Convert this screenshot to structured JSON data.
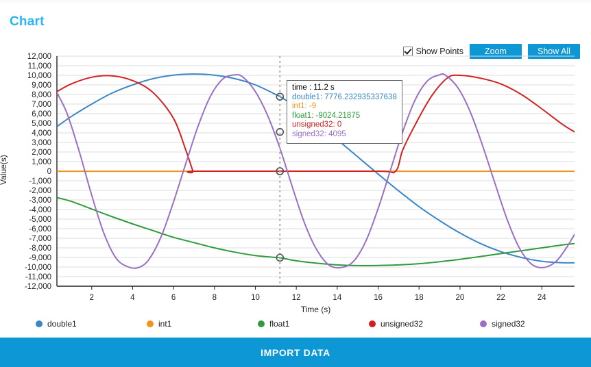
{
  "card": {
    "title": "Chart"
  },
  "toolbar": {
    "show_points_label": "Show Points",
    "show_points_checked": true,
    "zoom_label": "Zoom",
    "show_all_label": "Show All"
  },
  "import": {
    "label": "IMPORT DATA"
  },
  "tooltip": {
    "time": "time : 11.2 s",
    "rows": [
      {
        "text": "double1: 7776.232935337638",
        "color": "#3a87c8"
      },
      {
        "text": "int1: -9",
        "color": "#f0941e"
      },
      {
        "text": "float1: -9024.21875",
        "color": "#2e9b3c"
      },
      {
        "text": "unsigned32: 0",
        "color": "#d32020"
      },
      {
        "text": "signed32: 4095",
        "color": "#9b6fc4"
      }
    ]
  },
  "chart_data": {
    "type": "line",
    "title": "Chart",
    "xlabel": "Time (s)",
    "ylabel": "Value(s)",
    "xlim": [
      0.3,
      25.6
    ],
    "ylim": [
      -12000,
      12000
    ],
    "xticks": [
      2,
      4,
      6,
      8,
      10,
      12,
      14,
      16,
      18,
      20,
      22,
      24
    ],
    "yticks": [
      12000,
      11000,
      10000,
      9000,
      8000,
      7000,
      6000,
      5000,
      4000,
      3000,
      2000,
      1000,
      0,
      -1000,
      -2000,
      -3000,
      -4000,
      -5000,
      -6000,
      -7000,
      -8000,
      -9000,
      -10000,
      -11000,
      -12000
    ],
    "ytick_labels": [
      "12,000",
      "11,000",
      "10,000",
      "9,000",
      "8,000",
      "7,000",
      "6,000",
      "5,000",
      "4,000",
      "3,000",
      "2,000",
      "1,000",
      "0",
      "-1,000",
      "-2,000",
      "-3,000",
      "-4,000",
      "-5,000",
      "-6,000",
      "-7,000",
      "-8,000",
      "-9,000",
      "-10,000",
      "-11,000",
      "-12,000"
    ],
    "grid": true,
    "grid_color": "#dcdcdc",
    "legend_position": "bottom",
    "cursor_x": 11.2,
    "series": [
      {
        "name": "double1",
        "color": "#3a87c8",
        "marker_at_cursor": 7776.23,
        "points": [
          [
            0.3,
            4650
          ],
          [
            1.0,
            5700
          ],
          [
            2.0,
            7000
          ],
          [
            3.0,
            8150
          ],
          [
            4.0,
            9000
          ],
          [
            5.0,
            9650
          ],
          [
            6.0,
            10020
          ],
          [
            7.0,
            10130
          ],
          [
            8.0,
            10020
          ],
          [
            9.0,
            9650
          ],
          [
            10.0,
            9000
          ],
          [
            11.0,
            8000
          ],
          [
            11.2,
            7776
          ],
          [
            12.0,
            6700
          ],
          [
            13.0,
            5100
          ],
          [
            14.0,
            3300
          ],
          [
            15.0,
            1500
          ],
          [
            16.0,
            -300
          ],
          [
            17.0,
            -2050
          ],
          [
            18.0,
            -3700
          ],
          [
            19.0,
            -5150
          ],
          [
            20.0,
            -6450
          ],
          [
            21.0,
            -7550
          ],
          [
            22.0,
            -8400
          ],
          [
            23.0,
            -9000
          ],
          [
            24.0,
            -9400
          ],
          [
            25.0,
            -9550
          ],
          [
            25.6,
            -9560
          ]
        ]
      },
      {
        "name": "int1",
        "color": "#f0941e",
        "marker_at_cursor": -9,
        "points": [
          [
            0.3,
            -9
          ],
          [
            4,
            -9
          ],
          [
            8,
            -9
          ],
          [
            12,
            -9
          ],
          [
            16,
            -9
          ],
          [
            20,
            -9
          ],
          [
            24,
            -9
          ],
          [
            25.6,
            -9
          ]
        ]
      },
      {
        "name": "float1",
        "color": "#2e9b3c",
        "marker_at_cursor": -9024.22,
        "points": [
          [
            0.3,
            -2750
          ],
          [
            1.0,
            -3150
          ],
          [
            2.0,
            -3950
          ],
          [
            3.0,
            -4750
          ],
          [
            4.0,
            -5500
          ],
          [
            5.0,
            -6200
          ],
          [
            6.0,
            -6900
          ],
          [
            7.0,
            -7450
          ],
          [
            8.0,
            -8000
          ],
          [
            9.0,
            -8450
          ],
          [
            10.0,
            -8800
          ],
          [
            11.0,
            -9000
          ],
          [
            11.2,
            -9024
          ],
          [
            12.0,
            -9350
          ],
          [
            13.0,
            -9600
          ],
          [
            14.0,
            -9780
          ],
          [
            15.0,
            -9850
          ],
          [
            16.0,
            -9840
          ],
          [
            17.0,
            -9780
          ],
          [
            18.0,
            -9650
          ],
          [
            19.0,
            -9450
          ],
          [
            20.0,
            -9200
          ],
          [
            21.0,
            -8900
          ],
          [
            22.0,
            -8600
          ],
          [
            23.0,
            -8300
          ],
          [
            24.0,
            -8000
          ],
          [
            25.0,
            -7700
          ],
          [
            25.6,
            -7550
          ]
        ]
      },
      {
        "name": "unsigned32",
        "color": "#d32020",
        "marker_at_cursor": 0,
        "points": [
          [
            0.3,
            8300
          ],
          [
            1.0,
            9100
          ],
          [
            2.0,
            9800
          ],
          [
            3.0,
            9950
          ],
          [
            4.0,
            9450
          ],
          [
            5.0,
            8200
          ],
          [
            6.0,
            5500
          ],
          [
            6.6,
            2200
          ],
          [
            6.95,
            0
          ],
          [
            7.0,
            0
          ],
          [
            11.2,
            0
          ],
          [
            16.0,
            0
          ],
          [
            16.85,
            0
          ],
          [
            17.2,
            2200
          ],
          [
            17.8,
            4800
          ],
          [
            18.6,
            7800
          ],
          [
            19.4,
            9750
          ],
          [
            20.0,
            10000
          ],
          [
            21.0,
            9700
          ],
          [
            22.0,
            9100
          ],
          [
            23.0,
            8000
          ],
          [
            24.0,
            6500
          ],
          [
            25.0,
            4900
          ],
          [
            25.6,
            4100
          ]
        ]
      },
      {
        "name": "signed32",
        "color": "#9b6fc4",
        "marker_at_cursor": 4095,
        "points": [
          [
            0.3,
            8200
          ],
          [
            0.8,
            6000
          ],
          [
            1.4,
            2000
          ],
          [
            2.0,
            -2500
          ],
          [
            2.6,
            -6500
          ],
          [
            3.2,
            -9100
          ],
          [
            3.8,
            -10000
          ],
          [
            4.3,
            -10050
          ],
          [
            4.8,
            -9200
          ],
          [
            5.4,
            -6800
          ],
          [
            6.0,
            -3200
          ],
          [
            6.6,
            800
          ],
          [
            7.2,
            4700
          ],
          [
            7.8,
            7800
          ],
          [
            8.4,
            9600
          ],
          [
            9.0,
            10050
          ],
          [
            9.4,
            9800
          ],
          [
            10.0,
            8300
          ],
          [
            10.6,
            5800
          ],
          [
            11.2,
            2400
          ],
          [
            11.8,
            -1600
          ],
          [
            12.4,
            -5400
          ],
          [
            13.0,
            -8200
          ],
          [
            13.6,
            -9800
          ],
          [
            14.2,
            -10050
          ],
          [
            14.8,
            -9400
          ],
          [
            15.4,
            -7300
          ],
          [
            16.0,
            -3900
          ],
          [
            16.6,
            100
          ],
          [
            17.2,
            4100
          ],
          [
            17.8,
            7400
          ],
          [
            18.4,
            9400
          ],
          [
            19.0,
            10050
          ],
          [
            19.3,
            10000
          ],
          [
            19.9,
            8700
          ],
          [
            20.5,
            6200
          ],
          [
            21.1,
            2700
          ],
          [
            21.7,
            -1200
          ],
          [
            22.3,
            -5000
          ],
          [
            22.9,
            -8000
          ],
          [
            23.5,
            -9700
          ],
          [
            24.1,
            -10050
          ],
          [
            24.7,
            -9400
          ],
          [
            25.2,
            -8000
          ],
          [
            25.6,
            -6600
          ]
        ]
      }
    ]
  }
}
